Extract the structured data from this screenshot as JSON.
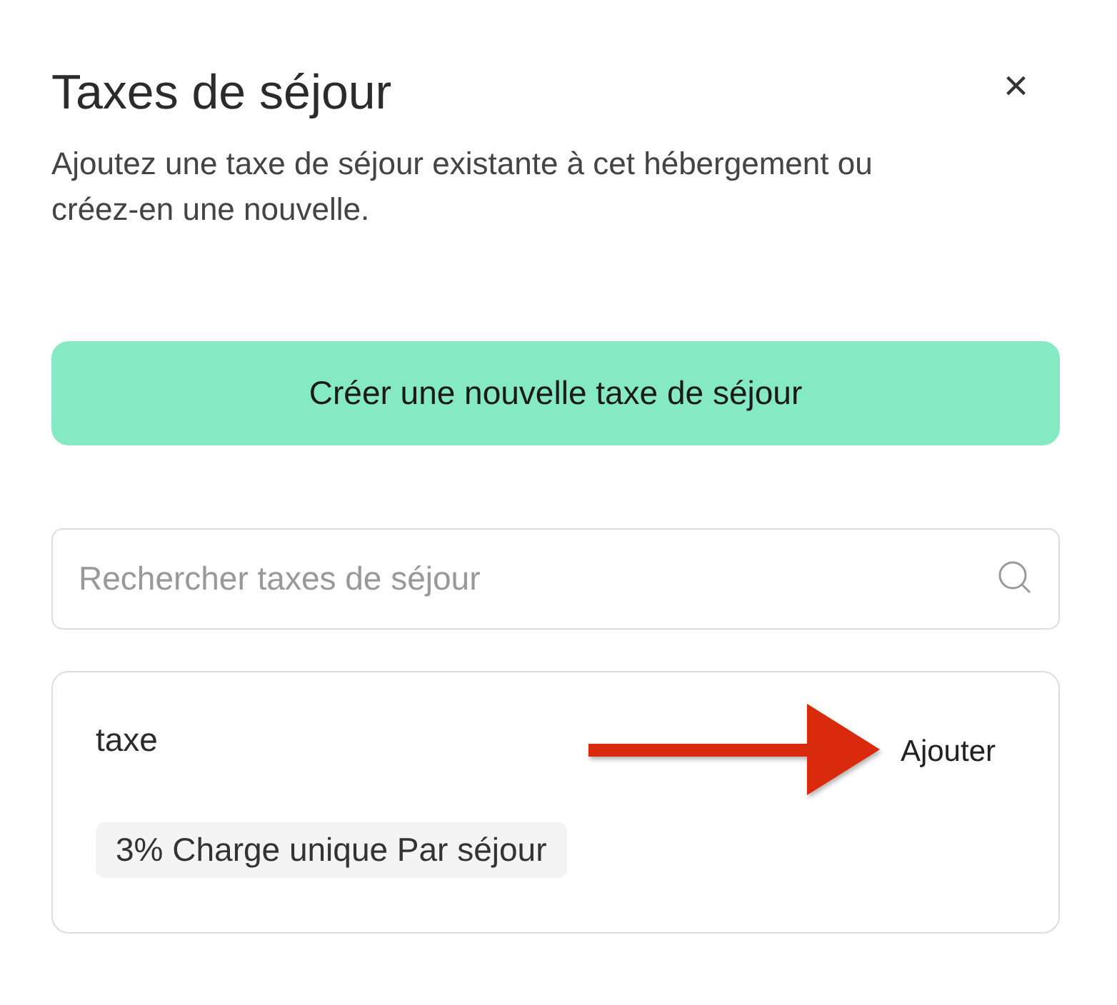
{
  "dialog": {
    "title": "Taxes de séjour",
    "close": "×",
    "description": "Ajoutez une taxe de séjour existante à cet hébergement ou créez-en une nouvelle."
  },
  "create_button": "Créer une nouvelle taxe de séjour",
  "search": {
    "placeholder": "Rechercher taxes de séjour"
  },
  "taxes": [
    {
      "name": "taxe",
      "tag": "3% Charge unique Par séjour",
      "action": "Ajouter",
      "highlighted": true
    }
  ]
}
